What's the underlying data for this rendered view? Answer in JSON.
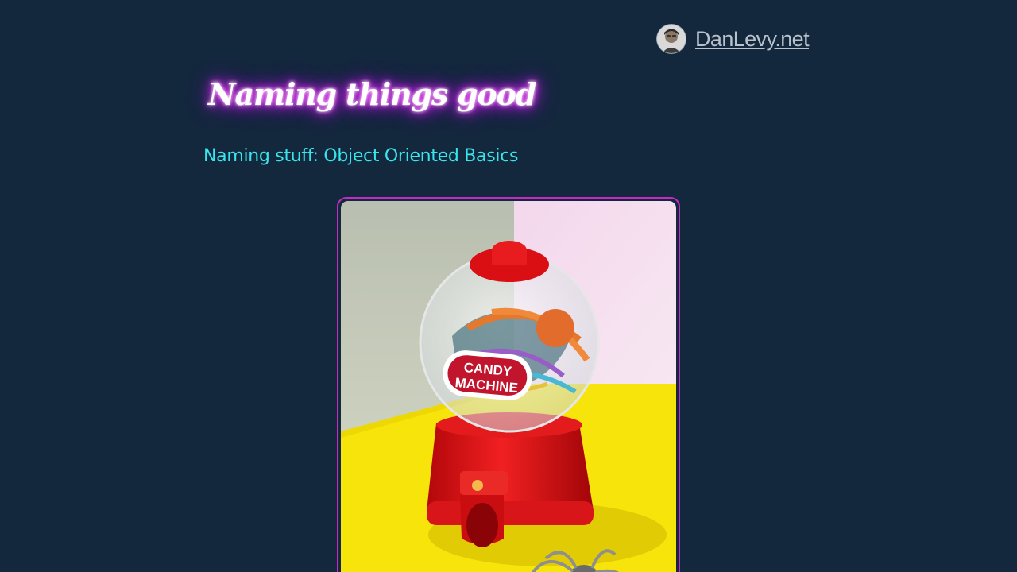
{
  "header": {
    "site_name": "DanLevy.net",
    "avatar_icon": "author-avatar-icon"
  },
  "post": {
    "title": "Naming things good",
    "subtitle": "Naming stuff: Object Oriented Basics"
  },
  "hero": {
    "sign_line1": "CANDY",
    "sign_line2": "MACHINE",
    "colors": {
      "frame_border": "#c72ac4",
      "title_glow": "#d11dff",
      "subtitle": "#38e6ee",
      "background": "#13273d"
    }
  }
}
